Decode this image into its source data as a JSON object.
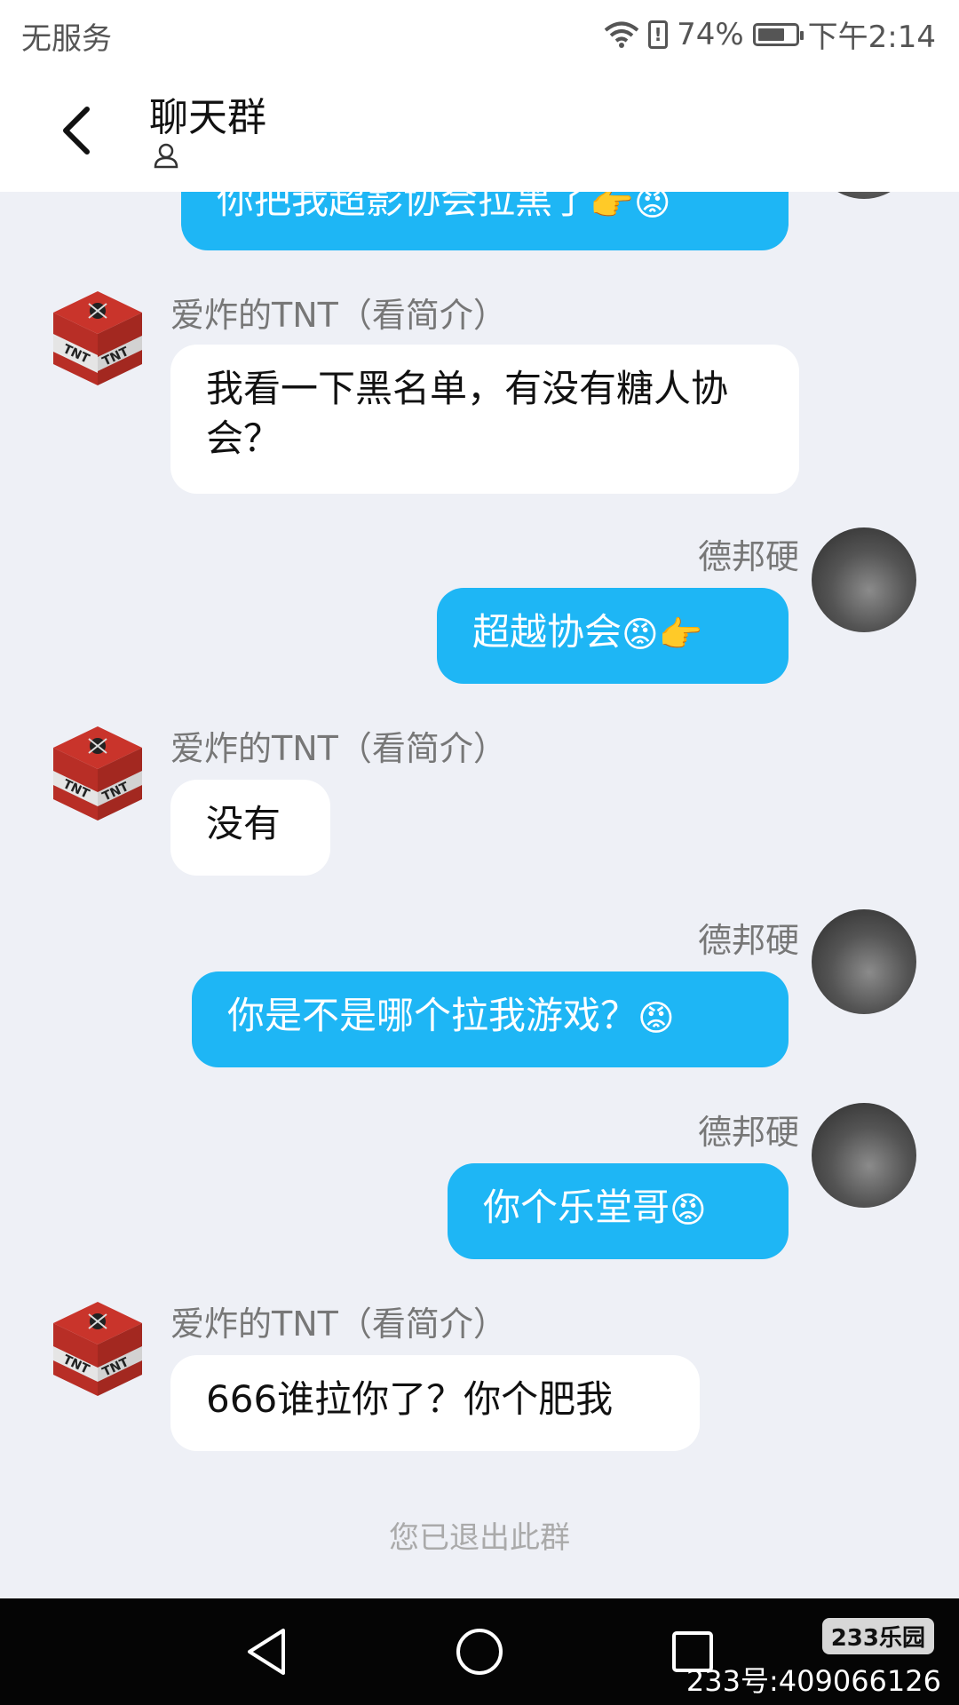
{
  "status_bar": {
    "carrier": "无服务",
    "battery": "74%",
    "battery_level": 0.74,
    "time": "下午2:14"
  },
  "header": {
    "title": "聊天群"
  },
  "messages": [
    {
      "dir": "out",
      "text": "你把我超影协会拉黑了",
      "emojis": [
        "👉",
        "😡"
      ]
    },
    {
      "dir": "in",
      "sender": "爱炸的TNT（看简介）",
      "text": "我看一下黑名单，有没有糖人协会？"
    },
    {
      "dir": "out",
      "sender": "德邦硬",
      "text": "超越协会",
      "emojis": [
        "😡",
        "👉"
      ]
    },
    {
      "dir": "in",
      "sender": "爱炸的TNT（看简介）",
      "text": "没有"
    },
    {
      "dir": "out",
      "sender": "德邦硬",
      "text": "你是不是哪个拉我游戏？",
      "emojis": [
        "😡"
      ]
    },
    {
      "dir": "out",
      "sender": "德邦硬",
      "text": "你个乐堂哥",
      "emojis": [
        "😡"
      ]
    },
    {
      "dir": "in",
      "sender": "爱炸的TNT（看简介）",
      "text": "666谁拉你了？你个肥我"
    }
  ],
  "system_message": "您已退出此群",
  "watermark": {
    "logo": "233乐园",
    "id": "233号:409066126"
  }
}
